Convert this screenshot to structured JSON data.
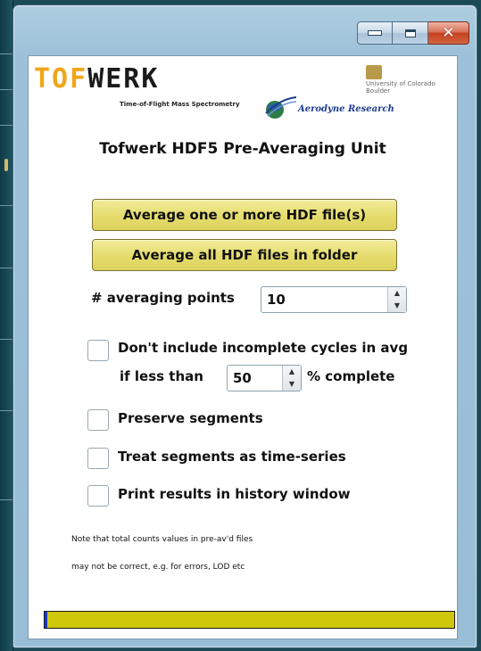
{
  "window": {
    "caption_icons": [
      "minimize-icon",
      "maximize-icon",
      "close-icon"
    ],
    "close_symbol": "✕"
  },
  "logos": {
    "tofwerk_part1": "TOF",
    "tofwerk_part2": "WERK",
    "tofwerk_tagline": "Time-of-Flight Mass Spectrometry",
    "cu_text": "University of Colorado Boulder",
    "aerodyne_text": "Aerodyne Research"
  },
  "title": "Tofwerk HDF5 Pre-Averaging Unit",
  "buttons": {
    "average_files": "Average one or more HDF file(s)",
    "average_folder": "Average all HDF files in folder"
  },
  "averaging_points": {
    "label": "# averaging points",
    "value": "10"
  },
  "incomplete_cycles": {
    "checked": false,
    "label_line1": "Don't include incomplete cycles in avg",
    "label_prefix": "if less than",
    "value": "50",
    "label_suffix": "% complete"
  },
  "options": [
    {
      "label": "Preserve segments",
      "checked": false
    },
    {
      "label": "Treat segments as time-series",
      "checked": false
    },
    {
      "label": "Print results in history window",
      "checked": false
    }
  ],
  "note": {
    "line1": "Note that total counts values in pre-av'd files",
    "line2": "may not be correct, e.g. for errors, LOD etc"
  },
  "progress": {
    "fraction": 0.007,
    "fill_color": "#1736c7",
    "track_color": "#cfc70a"
  }
}
